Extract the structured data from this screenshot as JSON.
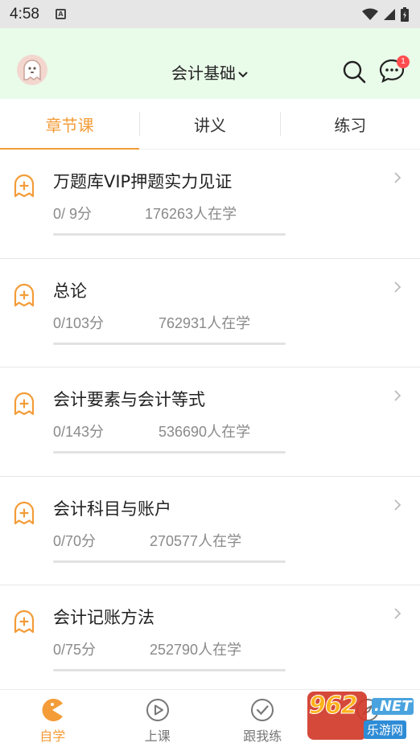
{
  "status_bar": {
    "time": "4:58",
    "notification_icon": "A"
  },
  "header": {
    "subject": "会计基础",
    "message_badge": "1"
  },
  "tabs": [
    {
      "label": "章节课",
      "active": true
    },
    {
      "label": "讲义",
      "active": false
    },
    {
      "label": "练习",
      "active": false
    }
  ],
  "chapters": [
    {
      "title": "万题库VIP押题实力见证",
      "score": "0/ 9分",
      "learners": "176263人在学",
      "progress": 0
    },
    {
      "title": "总论",
      "score": "0/103分",
      "learners": "762931人在学",
      "progress": 0
    },
    {
      "title": "会计要素与会计等式",
      "score": "0/143分",
      "learners": "536690人在学",
      "progress": 0
    },
    {
      "title": "会计科目与账户",
      "score": "0/70分",
      "learners": "270577人在学",
      "progress": 0
    },
    {
      "title": "会计记账方法",
      "score": "0/75分",
      "learners": "252790人在学",
      "progress": 0
    }
  ],
  "bottom_nav": [
    {
      "label": "自学",
      "icon": "pacman-icon",
      "active": true
    },
    {
      "label": "上课",
      "icon": "play-circle-icon",
      "active": false
    },
    {
      "label": "跟我练",
      "icon": "check-circle-icon",
      "active": false
    },
    {
      "label": "",
      "icon": "compass-icon",
      "active": false
    }
  ],
  "watermark": {
    "number": "962",
    "suffix": ".NET",
    "site": "乐游网"
  },
  "colors": {
    "accent": "#f39c38",
    "header_bg": "#e9fbe9",
    "badge": "#ff4d4f"
  }
}
